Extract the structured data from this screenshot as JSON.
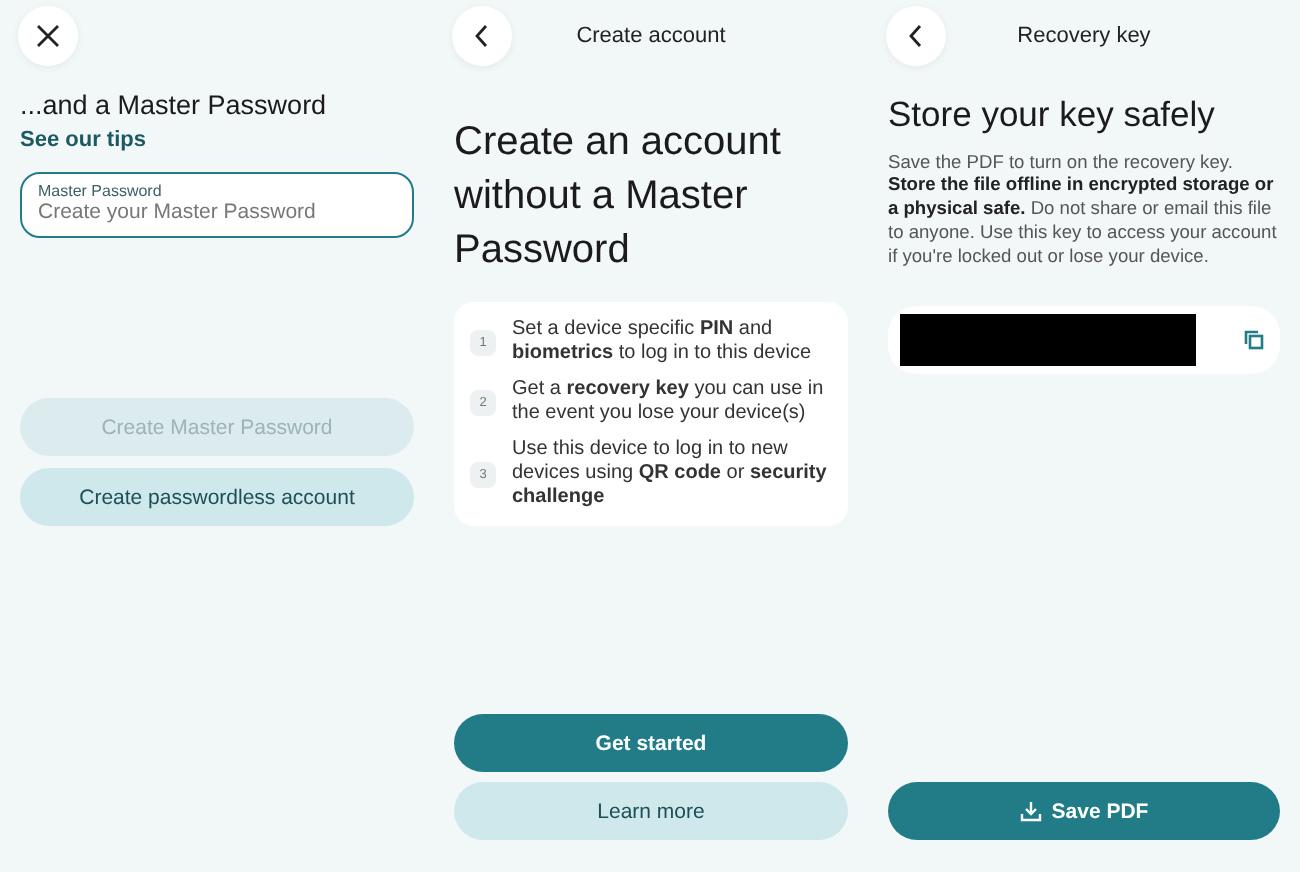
{
  "password_screen": {
    "heading": "...and a Master Password",
    "link": "See our tips",
    "field": {
      "label": "Master Password",
      "placeholder": "Create your Master Password"
    },
    "buttons": [
      {
        "label": "Create Master Password",
        "disabled": true
      },
      {
        "label": "Create passwordless account",
        "disabled": false
      }
    ]
  },
  "create_account_screen": {
    "title": "Create account",
    "heading": "Create an account without a Master Password",
    "steps": [
      {
        "number": "1",
        "text": "Set a device specific **PIN** and **biometrics** to log in to this device"
      },
      {
        "number": "2",
        "text": "Get a **recovery key** you can use in the event you lose your device(s)"
      },
      {
        "number": "3",
        "text": "Use this device to log in to new devices using **QR code** or **security challenge**"
      }
    ],
    "buttons": [
      {
        "label": "Get started",
        "kind": "primary"
      },
      {
        "label": "Learn more",
        "kind": "secondary"
      }
    ]
  },
  "recovery_key_screen": {
    "title": "Recovery key",
    "heading": "Store your key safely",
    "body": "Save the PDF to turn on the recovery key. **Store the file offline in encrypted storage or a physical safe.** Do not share or email this file to anyone. Use this key to access your account if you're locked out or lose your device.",
    "key_redacted": true,
    "button": {
      "label": "Save PDF",
      "kind": "primary"
    }
  }
}
